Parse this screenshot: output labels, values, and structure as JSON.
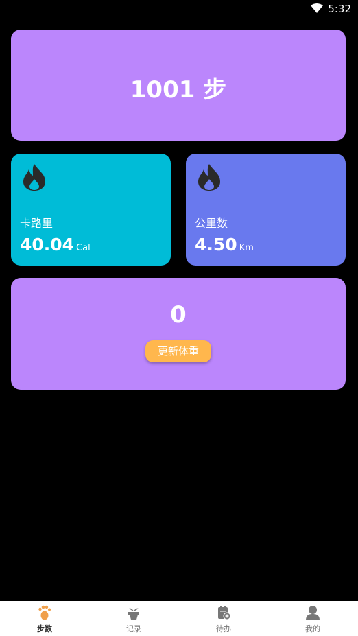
{
  "status": {
    "time": "5:32"
  },
  "steps": {
    "text": "1001 步"
  },
  "calories": {
    "label": "卡路里",
    "value": "40.04",
    "unit": "Cal"
  },
  "distance": {
    "label": "公里数",
    "value": "4.50",
    "unit": "Km"
  },
  "weight": {
    "value": "0",
    "button_label": "更新体重"
  },
  "nav": {
    "items": [
      {
        "label": "步数",
        "icon": "footprint-icon",
        "active": true
      },
      {
        "label": "记录",
        "icon": "plant-pot-icon",
        "active": false
      },
      {
        "label": "待办",
        "icon": "calendar-add-icon",
        "active": false
      },
      {
        "label": "我的",
        "icon": "person-icon",
        "active": false
      }
    ]
  },
  "colors": {
    "steps_card": "#bb86fc",
    "calories_card": "#00bcd7",
    "distance_card": "#6979ee",
    "weight_card": "#bb86fc",
    "update_button": "#ffb74d",
    "nav_active_icon": "#f0a04b"
  }
}
